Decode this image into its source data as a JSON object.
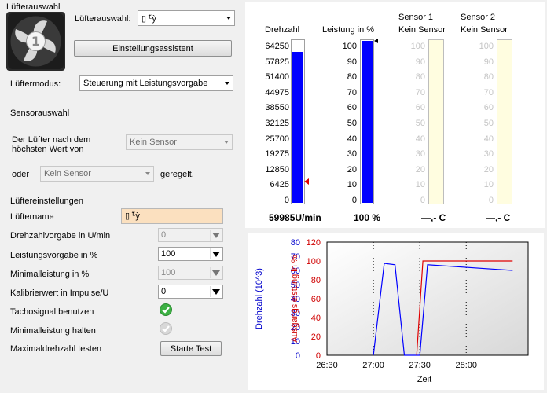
{
  "fan_section": {
    "title": "Lüfterauswahl"
  },
  "fan_select": {
    "label": "Lüfterauswahl:",
    "value": "▯ ᒻ̃ỳ"
  },
  "setup_assistant": {
    "label": "Einstellungsassistent"
  },
  "fan_mode": {
    "label": "Lüftermodus:",
    "value": "Steuerung mit Leistungsvorgabe"
  },
  "sensor_section": {
    "title": "Sensorauswahl",
    "line1": "Der Lüfter nach dem",
    "line2": "höchsten Wert von",
    "sensor1": "Kein Sensor",
    "or_label": "oder",
    "sensor2": "Kein Sensor",
    "regulated": "geregelt."
  },
  "fan_settings": {
    "title": "Lüftereinstellungen",
    "name_label": "Lüftername",
    "name_value": "▯ ᒻ̃ỳ",
    "speed_label": "Drehzahlvorgabe in U/min",
    "speed_value": "0",
    "power_label": "Leistungsvorgabe in %",
    "power_value": "100",
    "minpower_label": "Minimalleistung in %",
    "minpower_value": "100",
    "calib_label": "Kalibrierwert in Impulse/U",
    "calib_value": "0",
    "tacho_label": "Tachosignal benutzen",
    "tacho_checked": true,
    "holdmin_label": "Minimalleistung halten",
    "holdmin_checked": true,
    "maxtest_label": "Maximaldrehzahl testen",
    "start_test": "Starte Test"
  },
  "gauges": {
    "rpm": {
      "header": "Drehzahl",
      "ticks": [
        "64250",
        "57825",
        "51400",
        "44975",
        "38550",
        "32125",
        "25700",
        "19275",
        "12850",
        "6425",
        "0"
      ],
      "fill_fraction": 0.933,
      "readout": "59985U/min",
      "color": "#0000ff"
    },
    "power": {
      "header": "Leistung in %",
      "ticks": [
        "100",
        "90",
        "80",
        "70",
        "60",
        "50",
        "40",
        "30",
        "20",
        "10",
        "0"
      ],
      "fill_fraction": 1.0,
      "readout": "100 %",
      "color": "#0000ff"
    },
    "sensor1": {
      "header1": "Sensor 1",
      "header2": "Kein Sensor",
      "ticks": [
        "100",
        "90",
        "80",
        "70",
        "60",
        "50",
        "40",
        "30",
        "20",
        "10",
        "0"
      ],
      "readout": "—,- C",
      "color": "#fffde0"
    },
    "sensor2": {
      "header1": "Sensor 2",
      "header2": "Kein Sensor",
      "ticks": [
        "100",
        "90",
        "80",
        "70",
        "60",
        "50",
        "40",
        "30",
        "20",
        "10",
        "0"
      ],
      "readout": "—,- C",
      "color": "#fffde0"
    }
  },
  "chart_data": {
    "type": "line",
    "xlabel": "Zeit",
    "ylabel_left": "Drehzahl (10^3)",
    "ylabel_right": "Ausgangsleistung in %",
    "x_ticks": [
      "26:30",
      "27:00",
      "27:30",
      "28:00"
    ],
    "y_left_ticks": [
      "0",
      "10",
      "20",
      "30",
      "40",
      "50",
      "60",
      "70",
      "80"
    ],
    "y_right_ticks": [
      "0",
      "20",
      "40",
      "60",
      "80",
      "100",
      "120"
    ],
    "y_left_range": [
      0,
      80
    ],
    "y_right_range": [
      0,
      120
    ],
    "x_range_seconds": [
      1590,
      1720
    ],
    "series": [
      {
        "axis": "left",
        "color": "#0000ff",
        "points": [
          [
            1620,
            0
          ],
          [
            1627,
            65
          ],
          [
            1634,
            64
          ],
          [
            1640,
            0
          ],
          [
            1647,
            0
          ],
          [
            1650,
            0
          ],
          [
            1655,
            64
          ],
          [
            1710,
            60
          ]
        ]
      },
      {
        "axis": "right",
        "color": "#e00000",
        "points": [
          [
            1648,
            0
          ],
          [
            1652,
            100
          ],
          [
            1710,
            100
          ]
        ]
      }
    ]
  }
}
